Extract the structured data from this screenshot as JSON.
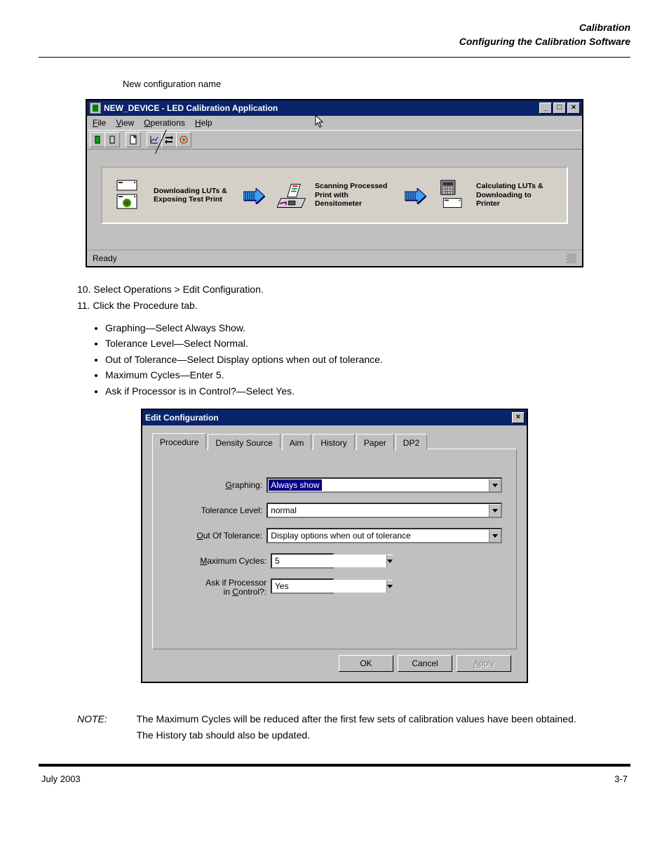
{
  "page_header": {
    "line1": "Calibration",
    "line2": "Configuring the Calibration Software"
  },
  "pointer_label": "New configuration name",
  "window1": {
    "title": "NEW_DEVICE - LED Calibration Application",
    "menus": [
      {
        "label": "File",
        "u": "F"
      },
      {
        "label": "View",
        "u": "V"
      },
      {
        "label": "Operations",
        "u": "O"
      },
      {
        "label": "Help",
        "u": "H"
      }
    ],
    "stages": [
      {
        "text": "Downloading LUTs & Exposing Test Print"
      },
      {
        "text": "Scanning Processed Print with Densitometer"
      },
      {
        "text": "Calculating LUTs & Downloading to Printer"
      }
    ],
    "status": "Ready"
  },
  "midtext": {
    "line1": "10. Select Operations > Edit Configuration.",
    "line2": "11. Click the Procedure tab.",
    "bullets": [
      "Graphing—Select Always Show.",
      "Tolerance Level—Select Normal.",
      "Out of Tolerance—Select Display options when out of tolerance.",
      "Maximum Cycles—Enter 5.",
      "Ask if Processor is in Control?—Select Yes."
    ]
  },
  "dialog": {
    "title": "Edit Configuration",
    "tabs": [
      "Procedure",
      "Density Source",
      "Aim",
      "History",
      "Paper",
      "DP2"
    ],
    "fields": {
      "graphing": {
        "label": "Graphing:",
        "u": "G",
        "value": "Always show"
      },
      "tolerance": {
        "label": "Tolerance Level:",
        "value": "normal"
      },
      "oot": {
        "label": "Out Of Tolerance:",
        "u": "O",
        "value": "Display options when out of tolerance"
      },
      "maxcycles": {
        "label": "Maximum Cycles:",
        "u": "M",
        "value": "5"
      },
      "askproc": {
        "label_line1": "Ask if Processor",
        "label_line2": "in Control?:",
        "u": "C",
        "value": "Yes"
      }
    },
    "buttons": {
      "ok": "OK",
      "cancel": "Cancel",
      "apply": "Apply"
    }
  },
  "note": {
    "label": "NOTE:",
    "text": "The Maximum Cycles will be reduced after the first few sets of calibration values have been obtained. The History tab should also be updated."
  },
  "footer": {
    "left": "July 2003",
    "right": "3-7"
  }
}
